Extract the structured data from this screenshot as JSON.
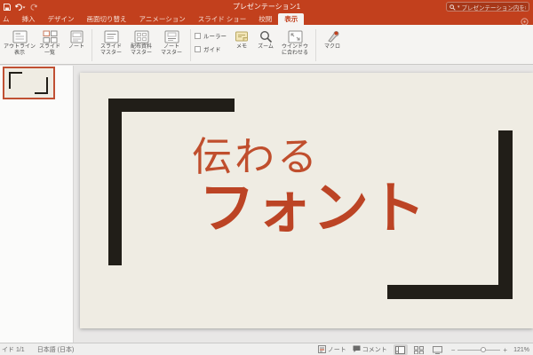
{
  "colors": {
    "accent": "#C2401D",
    "ribbon_background": "#F5F4F2",
    "slide_background": "#EFECE3",
    "slide_text": "#BC4425",
    "bracket": "#211E18"
  },
  "titlebar": {
    "title": "プレゼンテーション1",
    "search_placeholder": "プレゼンテーション内を検索"
  },
  "tabs": [
    {
      "label": "ム"
    },
    {
      "label": "挿入"
    },
    {
      "label": "デザイン"
    },
    {
      "label": "画面切り替え"
    },
    {
      "label": "アニメーション"
    },
    {
      "label": "スライド ショー"
    },
    {
      "label": "校閲"
    },
    {
      "label": "表示"
    }
  ],
  "ribbon": {
    "buttons": [
      {
        "l1": "アウトライン",
        "l2": "表示"
      },
      {
        "l1": "スライド",
        "l2": "一覧"
      },
      {
        "l1": "ノート",
        "l2": ""
      },
      {
        "l1": "スライド",
        "l2": "マスター"
      },
      {
        "l1": "配布資料",
        "l2": "マスター"
      },
      {
        "l1": "ノート",
        "l2": "マスター"
      },
      {
        "l1": "メモ",
        "l2": ""
      },
      {
        "l1": "ズーム",
        "l2": ""
      },
      {
        "l1": "ウインドウ",
        "l2": "に合わせる"
      },
      {
        "l1": "マクロ",
        "l2": ""
      }
    ],
    "checkboxes": [
      {
        "label": "ルーラー",
        "checked": false
      },
      {
        "label": "ガイド",
        "checked": false
      }
    ]
  },
  "slide": {
    "title_line1": "伝わる",
    "title_line2": "フォント"
  },
  "statusbar": {
    "slide_info": "イド 1/1",
    "language": "日本語 (日本)",
    "notes_label": "ノート",
    "comments_label": "コメント",
    "zoom_level": "121%"
  }
}
